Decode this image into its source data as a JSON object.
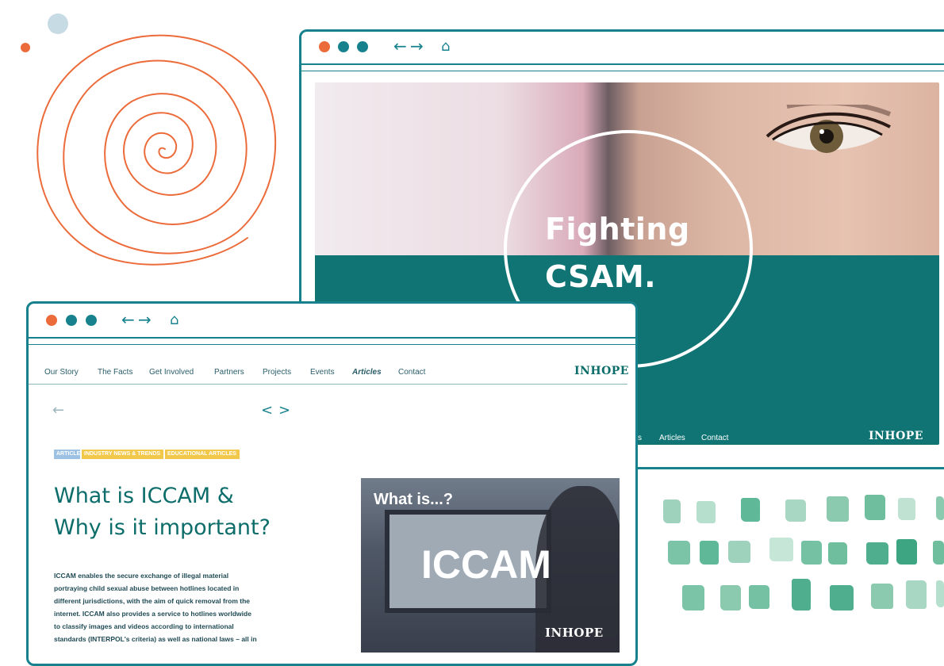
{
  "colors": {
    "teal": "#17828e",
    "dark_teal": "#0f7473",
    "orange": "#ec6b3b",
    "tag_blue": "#9cc1e2",
    "tag_yellow": "#f2c84b"
  },
  "back_window": {
    "nav_icons": [
      "back-arrow-icon",
      "forward-arrow-icon",
      "home-icon"
    ],
    "hero_line1": "Fighting",
    "hero_line2": "CSAM.",
    "nav_partial": "s",
    "nav_articles": "Articles",
    "nav_contact": "Contact",
    "logo": "INHOPE"
  },
  "front_window": {
    "nav_icons": [
      "back-arrow-icon",
      "forward-arrow-icon",
      "home-icon"
    ],
    "menu": [
      "Our Story",
      "The Facts",
      "Get Involved",
      "Partners",
      "Projects",
      "Events",
      "Articles",
      "Contact"
    ],
    "logo": "INHOPE",
    "tags": [
      "ARTICLE",
      "INDUSTRY NEWS & TRENDS",
      "EDUCATIONAL ARTICLES"
    ],
    "title_line1": "What is ICCAM &",
    "title_line2": "Why is it important?",
    "body_lines": [
      "ICCAM enables the secure exchange of illegal material",
      "portraying child sexual abuse between hotlines located in",
      "different jurisdictions, with the aim of quick removal from the",
      "internet. ICCAM also provides a service to hotlines worldwide",
      "to classify images and videos according to international",
      "standards (INTERPOL's criteria) as well as national laws – all in"
    ],
    "thumb_heading": "What is...?",
    "thumb_big": "ICCAM",
    "thumb_logo": "INHOPE"
  }
}
